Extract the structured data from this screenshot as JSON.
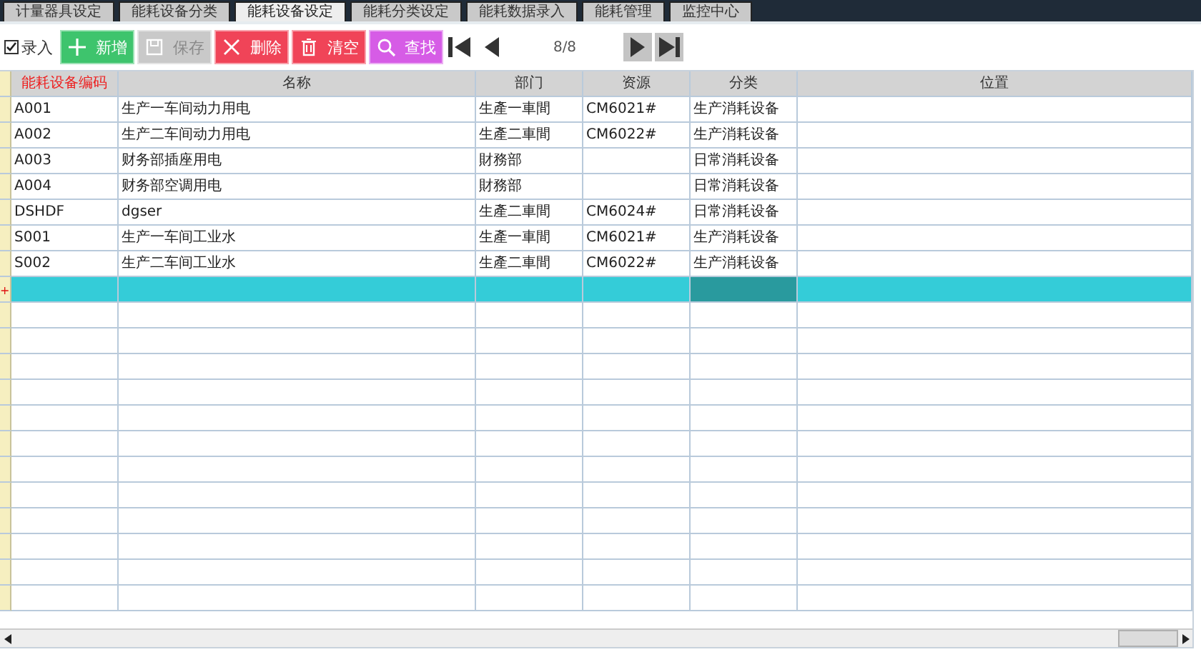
{
  "tabs": [
    {
      "label": "计量器具设定",
      "selected": false
    },
    {
      "label": "能耗设备分类",
      "selected": false
    },
    {
      "label": "能耗设备设定",
      "selected": true
    },
    {
      "label": "能耗分类设定",
      "selected": false
    },
    {
      "label": "能耗数据录入",
      "selected": false
    },
    {
      "label": "能耗管理",
      "selected": false
    },
    {
      "label": "监控中心",
      "selected": false
    }
  ],
  "toolbar": {
    "entry_checkbox": {
      "label": "录入",
      "checked": true
    },
    "buttons": [
      {
        "kind": "add",
        "label": "新增",
        "disabled": false
      },
      {
        "kind": "save",
        "label": "保存",
        "disabled": true
      },
      {
        "kind": "delete",
        "label": "删除",
        "disabled": false
      },
      {
        "kind": "clear",
        "label": "清空",
        "disabled": false
      },
      {
        "kind": "search",
        "label": "查找",
        "disabled": false
      }
    ],
    "navigation": [
      {
        "kind": "first",
        "disabled": false
      },
      {
        "kind": "prev",
        "disabled": false
      },
      {
        "kind": "next",
        "disabled": true
      },
      {
        "kind": "last",
        "disabled": true
      }
    ],
    "page": "8/8"
  },
  "table": {
    "columns": [
      {
        "label": "能耗设备编码",
        "required": true
      },
      {
        "label": "名称",
        "required": false
      },
      {
        "label": "部门",
        "required": false
      },
      {
        "label": "资源",
        "required": false
      },
      {
        "label": "分类",
        "required": false
      },
      {
        "label": "位置",
        "required": false
      }
    ],
    "rows": [
      {
        "cells": [
          "A001",
          "生产一车间动力用电",
          "生產一車間",
          "CM6021#",
          "生产消耗设备",
          null
        ]
      },
      {
        "cells": [
          "A002",
          "生产二车间动力用电",
          "生產二車間",
          "CM6022#",
          "生产消耗设备",
          null
        ]
      },
      {
        "cells": [
          "A003",
          "财务部插座用电",
          "財務部",
          null,
          "日常消耗设备",
          null
        ]
      },
      {
        "cells": [
          "A004",
          "财务部空调用电",
          "財務部",
          null,
          "日常消耗设备",
          null
        ]
      },
      {
        "cells": [
          "DSHDF",
          "dgser",
          "生產二車間",
          "CM6024#",
          "日常消耗设备",
          null
        ]
      },
      {
        "cells": [
          "S001",
          "生产一车间工业水",
          "生產一車間",
          "CM6021#",
          "生产消耗设备",
          null
        ]
      },
      {
        "cells": [
          "S002",
          "生产二车间工业水",
          "生產二車間",
          "CM6022#",
          "生产消耗设备",
          null
        ]
      }
    ],
    "new_row": {
      "marker": "+",
      "selected": true,
      "cells": [
        {
          "selected": false
        },
        {
          "selected": false
        },
        {
          "selected": false
        },
        {
          "selected": false
        },
        {
          "selected": true
        },
        {
          "selected": false
        }
      ]
    }
  }
}
